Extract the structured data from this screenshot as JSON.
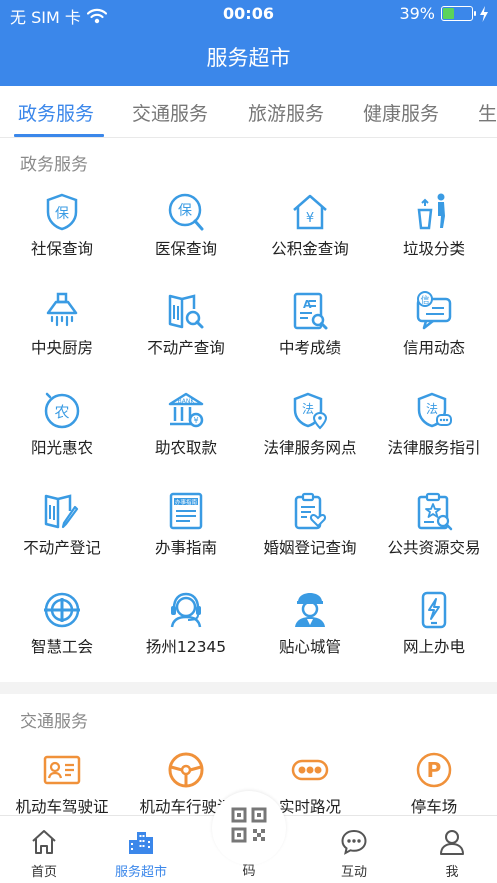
{
  "status_bar": {
    "carrier": "无 SIM 卡",
    "time": "00:06",
    "battery_percent": "39%",
    "battery_level": 0.39,
    "wifi_icon": "wifi-icon",
    "charging_icon": "bolt-icon"
  },
  "header": {
    "title": "服务超市"
  },
  "tabs": [
    {
      "label": "政务服务",
      "active": true
    },
    {
      "label": "交通服务",
      "active": false
    },
    {
      "label": "旅游服务",
      "active": false
    },
    {
      "label": "健康服务",
      "active": false
    },
    {
      "label": "生",
      "active": false
    }
  ],
  "sections": [
    {
      "title": "政务服务",
      "items": [
        {
          "label": "社保查询",
          "icon": "shield-bao-icon"
        },
        {
          "label": "医保查询",
          "icon": "bubble-bao-icon"
        },
        {
          "label": "公积金查询",
          "icon": "house-yuan-icon"
        },
        {
          "label": "垃圾分类",
          "icon": "trash-person-icon"
        },
        {
          "label": "中央厨房",
          "icon": "range-hood-icon"
        },
        {
          "label": "不动产查询",
          "icon": "book-search-icon"
        },
        {
          "label": "中考成绩",
          "icon": "doc-score-icon"
        },
        {
          "label": "信用动态",
          "icon": "credit-bubble-icon"
        },
        {
          "label": "阳光惠农",
          "icon": "nong-coin-icon"
        },
        {
          "label": "助农取款",
          "icon": "bank-icon"
        },
        {
          "label": "法律服务网点",
          "icon": "law-pin-icon"
        },
        {
          "label": "法律服务指引",
          "icon": "law-chat-icon"
        },
        {
          "label": "不动产登记",
          "icon": "book-pen-icon"
        },
        {
          "label": "办事指南",
          "icon": "guide-doc-icon"
        },
        {
          "label": "婚姻登记查询",
          "icon": "marriage-doc-icon"
        },
        {
          "label": "公共资源交易",
          "icon": "clipboard-star-icon"
        },
        {
          "label": "智慧工会",
          "icon": "union-logo-icon"
        },
        {
          "label": "扬州12345",
          "icon": "headset-icon"
        },
        {
          "label": "贴心城管",
          "icon": "officer-icon"
        },
        {
          "label": "网上办电",
          "icon": "phone-power-icon"
        }
      ]
    },
    {
      "title": "交通服务",
      "items": [
        {
          "label": "机动车驾驶证",
          "icon": "license-icon"
        },
        {
          "label": "机动车行驶证",
          "icon": "steering-wheel-icon"
        },
        {
          "label": "实时路况",
          "icon": "traffic-icon"
        },
        {
          "label": "停车场",
          "icon": "parking-icon"
        }
      ]
    }
  ],
  "bottom_nav": [
    {
      "label": "首页",
      "icon": "home-icon",
      "active": false
    },
    {
      "label": "服务超市",
      "icon": "buildings-icon",
      "active": true
    },
    {
      "label": "码",
      "icon": "qr-code-icon",
      "active": false
    },
    {
      "label": "互动",
      "icon": "chat-icon",
      "active": false
    },
    {
      "label": "我",
      "icon": "person-icon",
      "active": false
    }
  ],
  "colors": {
    "primary": "#3b87ea",
    "icon_blue": "#3a9be3",
    "icon_orange": "#f0913a",
    "text": "#222222",
    "muted": "#8a8a8a"
  }
}
